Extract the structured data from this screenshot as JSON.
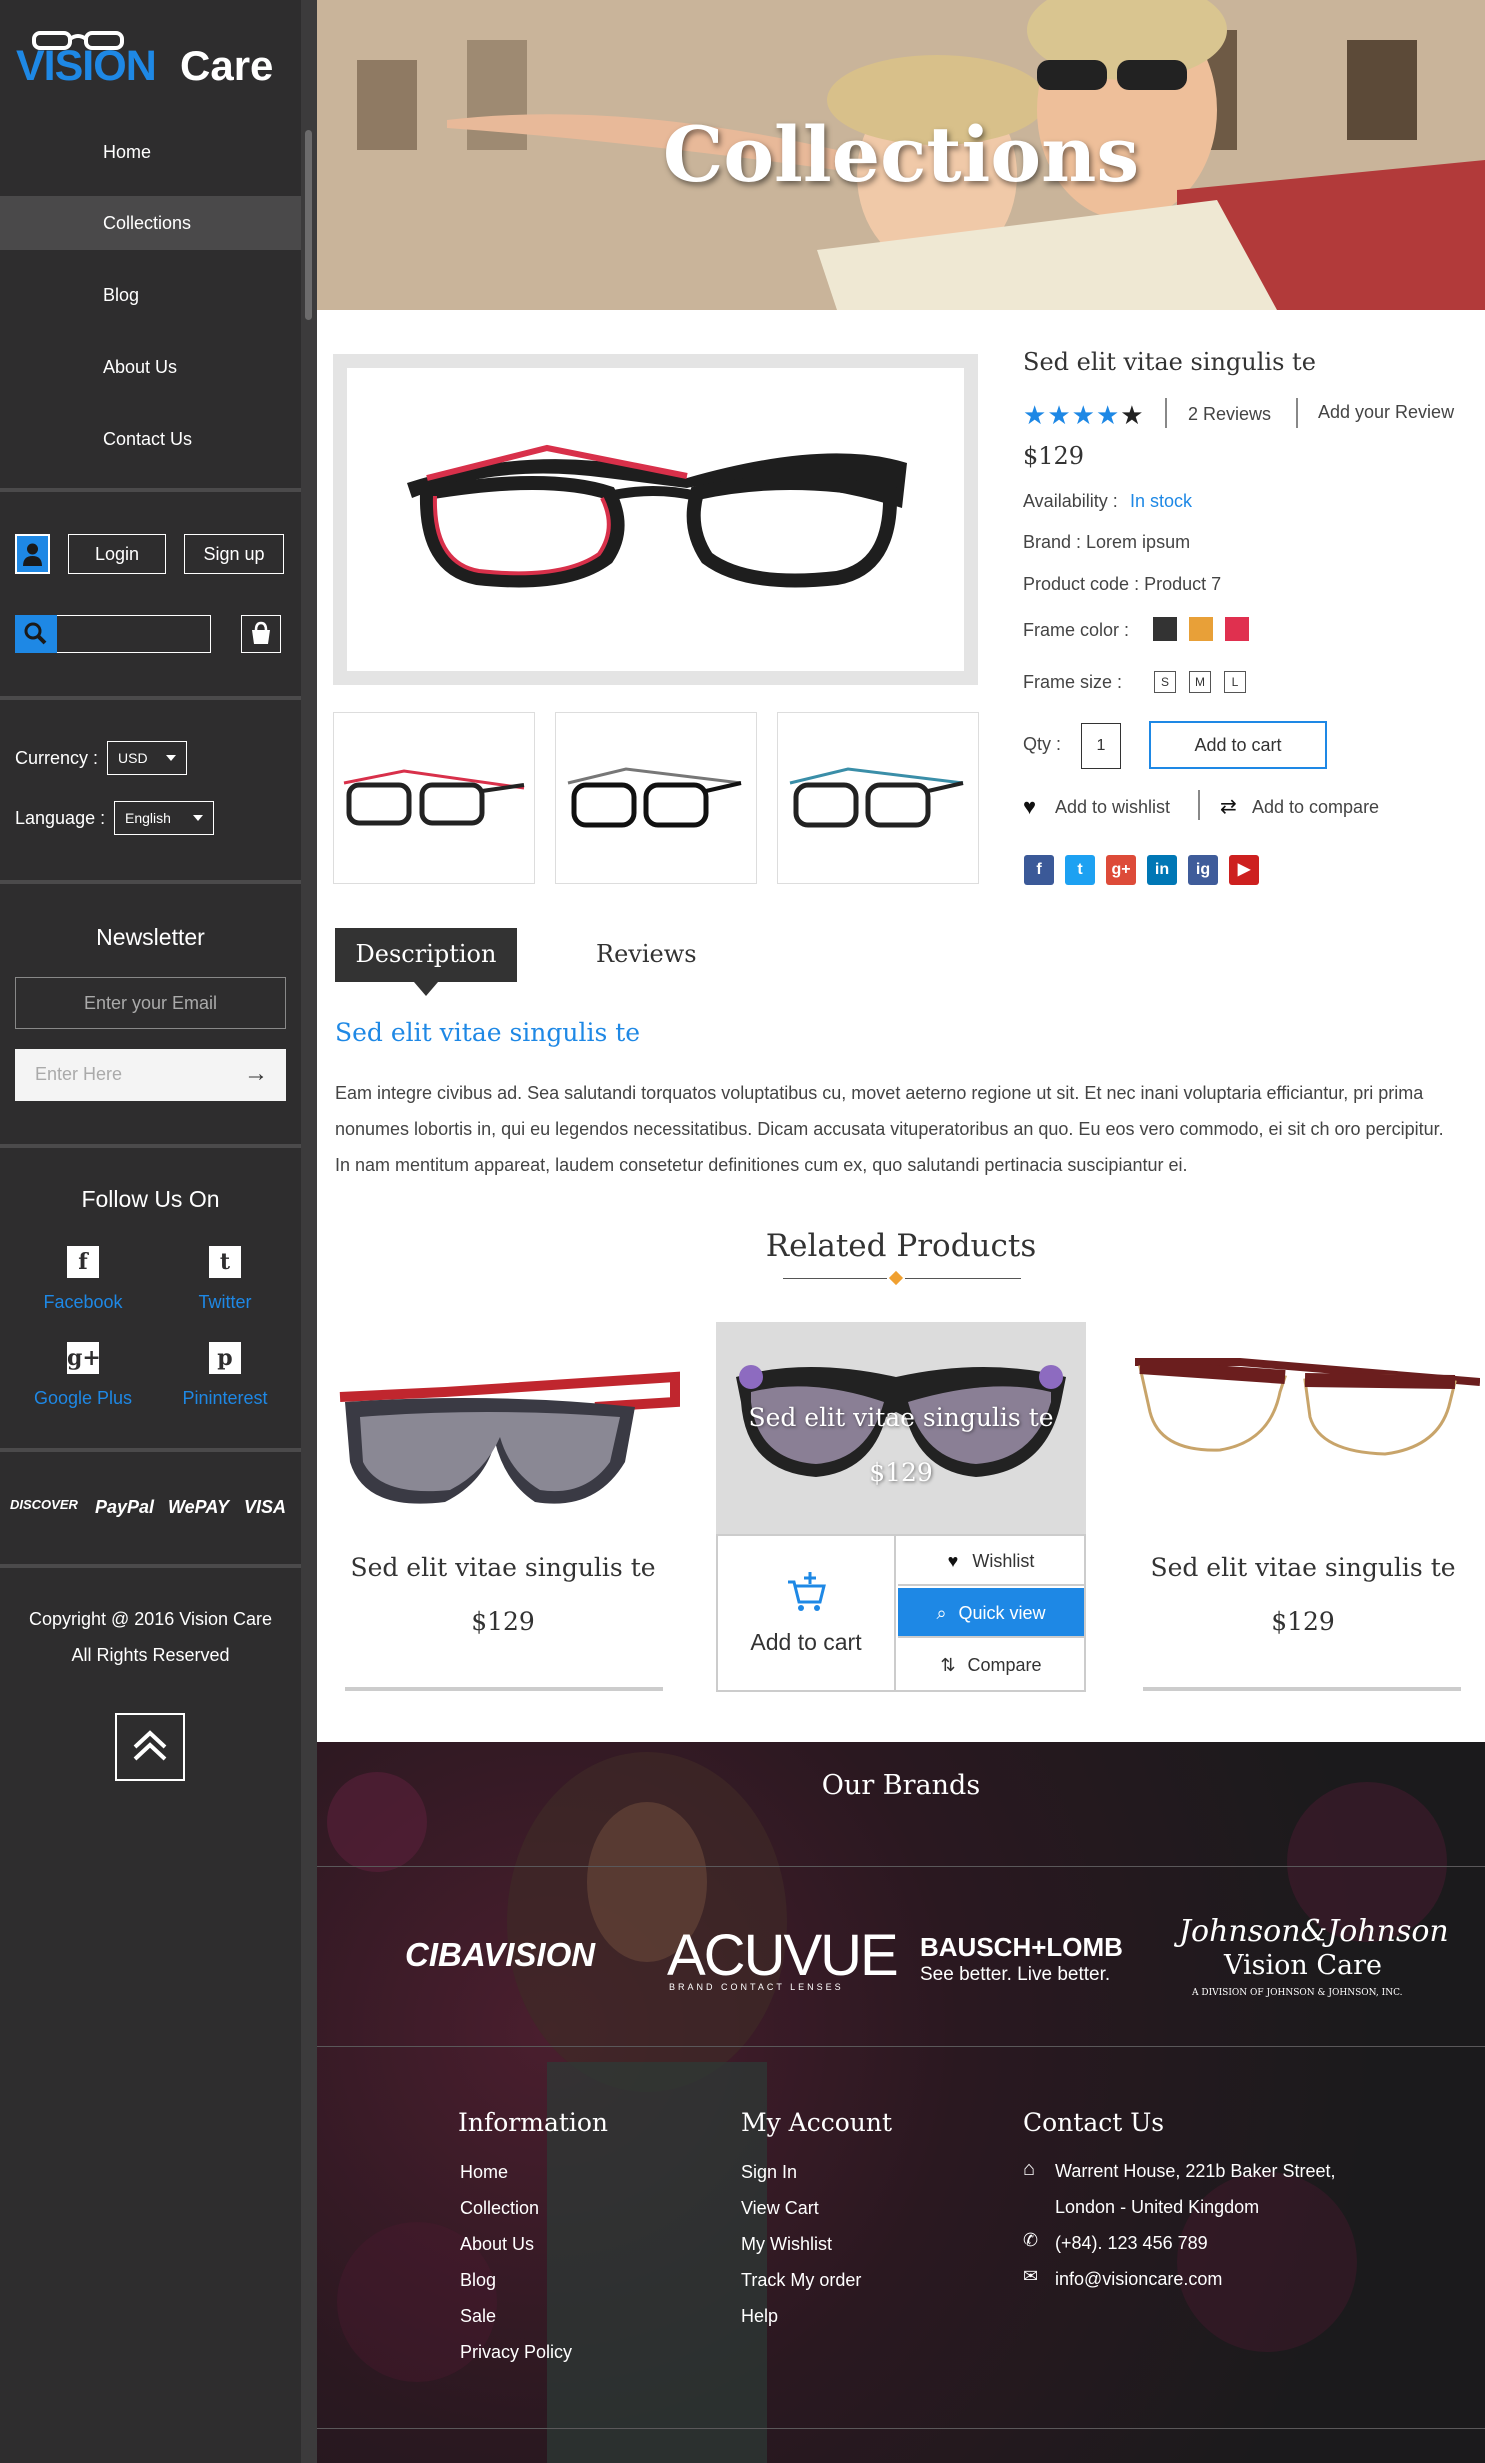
{
  "sidebar": {
    "logo": {
      "vision": "VISION",
      "care": "Care"
    },
    "nav": [
      {
        "label": "Home",
        "active": false
      },
      {
        "label": "Collections",
        "active": true
      },
      {
        "label": "Blog",
        "active": false
      },
      {
        "label": "About Us",
        "active": false
      },
      {
        "label": "Contact Us",
        "active": false
      }
    ],
    "login_label": "Login",
    "signup_label": "Sign up",
    "search_placeholder": "",
    "currency_label": "Currency :",
    "currency_value": "USD",
    "language_label": "Language :",
    "language_value": "English",
    "newsletter_title": "Newsletter",
    "email_placeholder": "Enter your Email",
    "enter_placeholder": "Enter Here",
    "follow_title": "Follow Us On",
    "social": [
      {
        "label": "Facebook",
        "icon": "facebook-icon"
      },
      {
        "label": "Twitter",
        "icon": "twitter-icon"
      },
      {
        "label": "Google Plus",
        "icon": "google-plus-icon"
      },
      {
        "label": "Pininterest",
        "icon": "pinterest-icon"
      }
    ],
    "payments": [
      "DISCOVER",
      "PayPal",
      "WePAY",
      "VISA"
    ],
    "copyright_line1": "Copyright @ 2016 Vision Care",
    "copyright_line2": "All Rights Reserved"
  },
  "hero": {
    "title": "Collections"
  },
  "product": {
    "title": "Sed elit vitae singulis te",
    "rating": 4,
    "rating_max": 5,
    "reviews_label": "2 Reviews",
    "add_review_label": "Add your Review",
    "price": "$129",
    "availability_label": "Availability :",
    "availability_value": "In stock",
    "brand_text": "Brand : Lorem ipsum",
    "code_text": "Product code : Product 7",
    "frame_color_label": "Frame color :",
    "frame_colors": [
      "#333333",
      "#e8a038",
      "#e0304f"
    ],
    "frame_size_label": "Frame size :",
    "sizes": [
      "S",
      "M",
      "L"
    ],
    "qty_label": "Qty :",
    "qty_value": "1",
    "add_to_cart_label": "Add to cart",
    "wishlist_label": "Add to wishlist",
    "compare_label": "Add to compare",
    "share": [
      {
        "icon": "facebook-icon",
        "color": "#3b5998",
        "glyph": "f"
      },
      {
        "icon": "twitter-icon",
        "color": "#1da1f2",
        "glyph": "t"
      },
      {
        "icon": "google-plus-icon",
        "color": "#dd4b39",
        "glyph": "g+"
      },
      {
        "icon": "linkedin-icon",
        "color": "#0077b5",
        "glyph": "in"
      },
      {
        "icon": "instagram-icon",
        "color": "#3f5c9a",
        "glyph": "ig"
      },
      {
        "icon": "youtube-icon",
        "color": "#cd201f",
        "glyph": "▶"
      }
    ]
  },
  "tabs": {
    "description": "Description",
    "reviews": "Reviews"
  },
  "description": {
    "title": "Sed elit vitae singulis te",
    "body": "Eam integre civibus ad. Sea salutandi torquatos voluptatibus cu, movet aeterno regione ut sit. Et nec inani voluptaria efficiantur, pri prima nonumes lobortis in, qui eu legendos necessitatibus. Dicam accusata vituperatoribus an quo. Eu eos vero commodo, ei sit ch oro percipitur. In nam mentitum appareat, laudem consetetur definitiones cum ex, quo salutandi pertinacia suscipiantur ei."
  },
  "related": {
    "title": "Related Products",
    "items": [
      {
        "name": "Sed elit vitae singulis te",
        "price": "$129"
      },
      {
        "name": "Sed elit vitae singulis te",
        "price": "$129"
      },
      {
        "name": "Sed elit vitae singulis te",
        "price": "$129"
      }
    ],
    "hover": {
      "add_to_cart": "Add to cart",
      "wishlist": "Wishlist",
      "quick_view": "Quick view",
      "compare": "Compare"
    }
  },
  "footer": {
    "brands_title": "Our Brands",
    "brands": [
      "CIBAVISION",
      "ACUVUE",
      "BRAND CONTACT LENSES",
      "BAUSCH+LOMB",
      "See better. Live better.",
      "Johnson&Johnson",
      "Vision Care",
      "A DIVISION OF JOHNSON & JOHNSON, INC."
    ],
    "information": {
      "title": "Information",
      "links": [
        "Home",
        "Collection",
        "About Us",
        "Blog",
        "Sale",
        "Privacy Policy"
      ]
    },
    "account": {
      "title": "My Account",
      "links": [
        "Sign In",
        "View Cart",
        "My Wishlist",
        "Track My order",
        "Help"
      ]
    },
    "contact": {
      "title": "Contact Us",
      "address1": "Warrent House, 221b Baker Street,",
      "address2": "London - United Kingdom",
      "phone": "(+84). 123 456 789",
      "email": "info@visioncare.com"
    }
  }
}
